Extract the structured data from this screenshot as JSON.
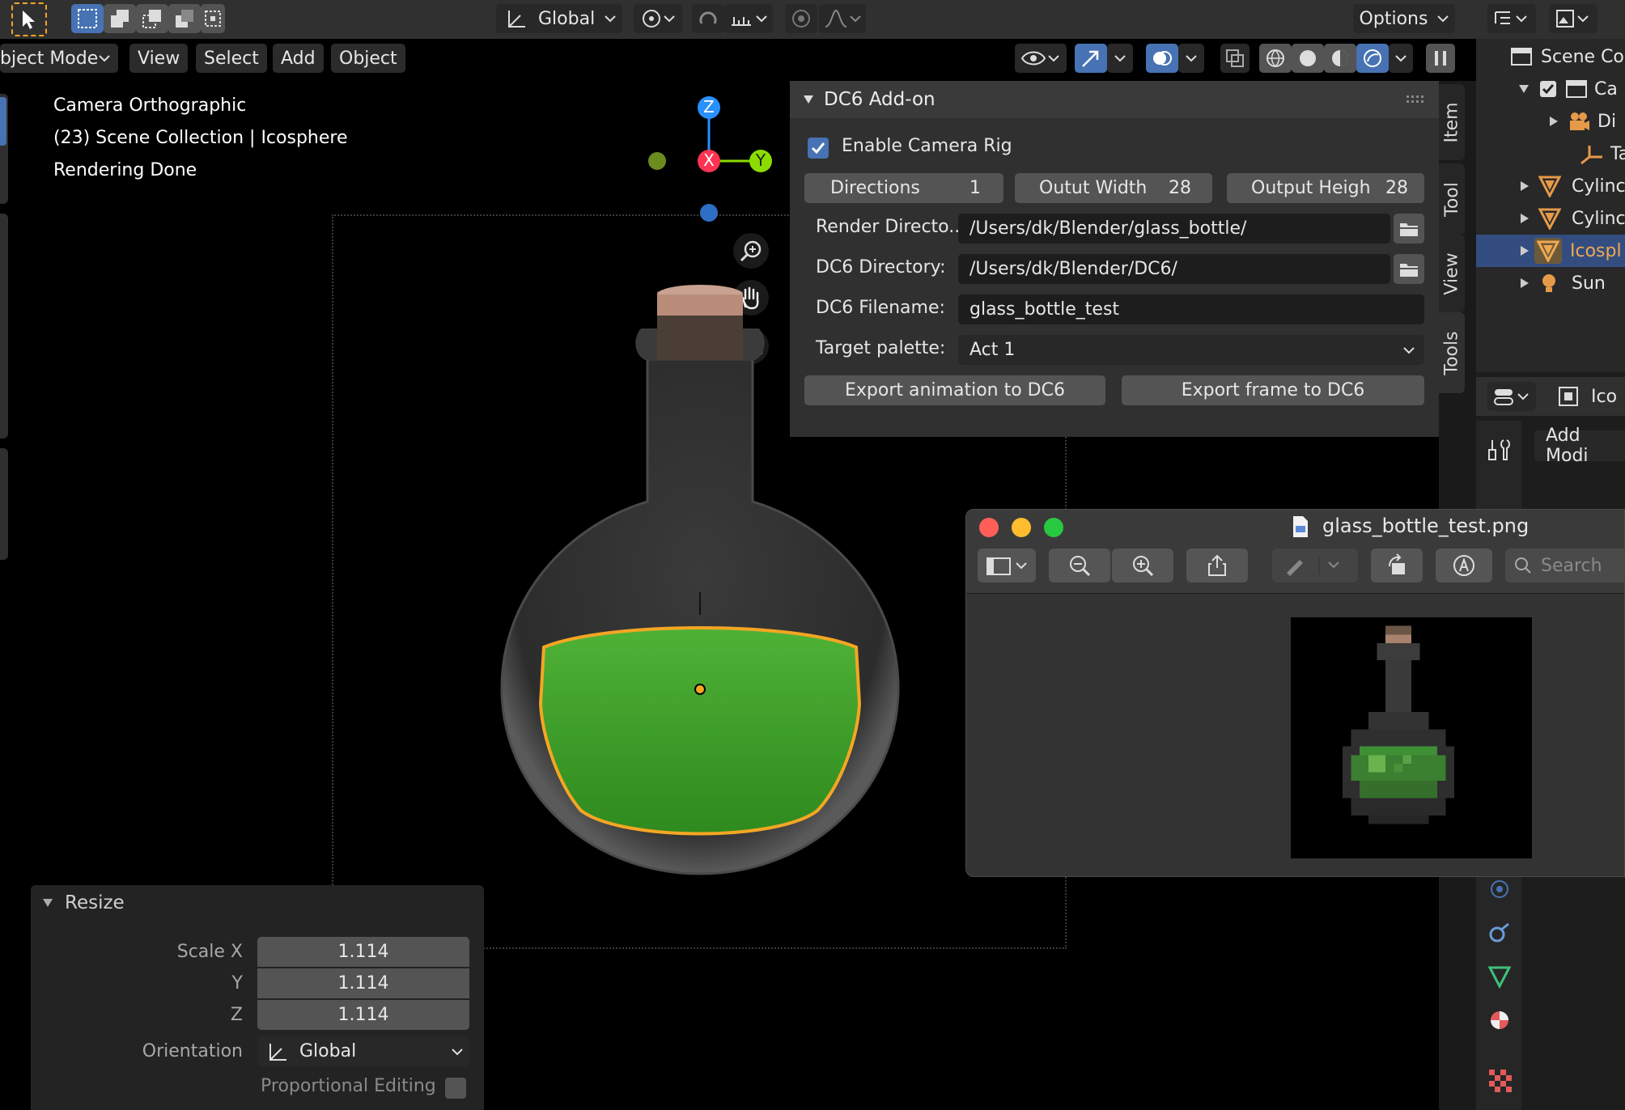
{
  "header": {
    "transform_orientation": "Global",
    "options_label": "Options",
    "mode_label": "bject Mode",
    "menus": [
      "View",
      "Select",
      "Add",
      "Object"
    ]
  },
  "viewport": {
    "info_lines": [
      "Camera Orthographic",
      "(23) Scene Collection | Icosphere",
      "Rendering Done"
    ],
    "gizmo_axes": {
      "z": "Z",
      "x": "X",
      "y": "Y"
    }
  },
  "addon_panel": {
    "title": "DC6 Add-on",
    "enable_camera_rig_label": "Enable Camera Rig",
    "enable_camera_rig_checked": true,
    "directions_label": "Directions",
    "directions_value": "1",
    "output_width_label": "Outut Width",
    "output_width_value": "28",
    "output_height_label": "Output Heigh",
    "output_height_value": "28",
    "render_dir_label": "Render Directo..",
    "render_dir_value": "/Users/dk/Blender/glass_bottle/",
    "dc6_dir_label": "DC6 Directory:",
    "dc6_dir_value": "/Users/dk/Blender/DC6/",
    "dc6_filename_label": "DC6 Filename:",
    "dc6_filename_value": "glass_bottle_test",
    "target_palette_label": "Target palette:",
    "target_palette_value": "Act 1",
    "export_animation_label": "Export animation to DC6",
    "export_frame_label": "Export frame to DC6"
  },
  "side_tabs": [
    "Item",
    "Tool",
    "View",
    "Tools"
  ],
  "outliner": {
    "root": "Scene Co",
    "items": [
      {
        "label": "Ca",
        "icon": "collection-icon"
      },
      {
        "label": "Di",
        "icon": "camera-icon"
      },
      {
        "label": "Ta",
        "icon": "empty-axes-icon"
      },
      {
        "label": "Cylinc",
        "icon": "mesh-icon"
      },
      {
        "label": "Cylinc",
        "icon": "mesh-icon"
      },
      {
        "label": "Icospl",
        "icon": "mesh-icon",
        "selected": true
      },
      {
        "label": "Sun",
        "icon": "light-icon"
      }
    ]
  },
  "properties": {
    "object_name": "Ico",
    "add_modifier_label": "Add Modi"
  },
  "image_viewer": {
    "filename": "glass_bottle_test.png",
    "search_placeholder": "Search"
  },
  "resize_panel": {
    "title": "Resize",
    "scale_x_label": "Scale X",
    "scale_x": "1.114",
    "y_label": "Y",
    "scale_y": "1.114",
    "z_label": "Z",
    "scale_z": "1.114",
    "orientation_label": "Orientation",
    "orientation_value": "Global",
    "proportional_label": "Proportional Editing",
    "proportional_checked": false
  },
  "colors": {
    "accent_blue": "#4772b3",
    "liquid_green": "#3f9a2a",
    "selection_orange": "#f5a623",
    "axis_x": "#ff3352",
    "axis_y": "#8bdc00",
    "axis_z": "#2890ff"
  }
}
